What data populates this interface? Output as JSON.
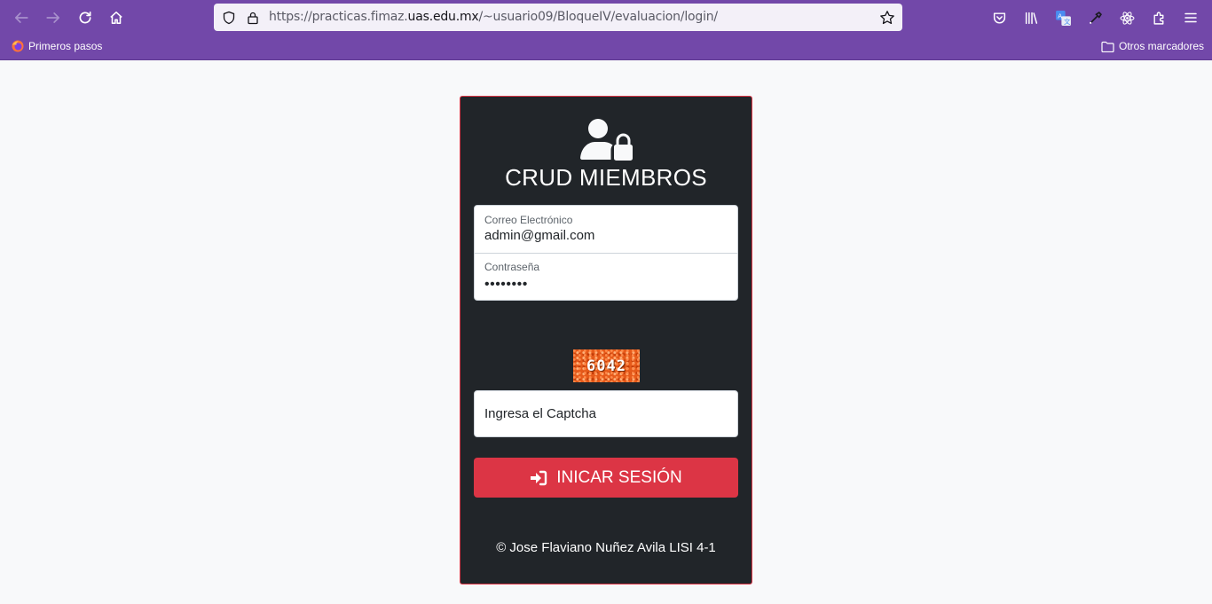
{
  "browser": {
    "url_prefix": "https://practicas.fimaz.",
    "url_host": "uas.edu.mx",
    "url_path": "/~usuario09/BloqueIV/evaluacion/login/",
    "bookmarks": {
      "left": {
        "label": "Primeros pasos",
        "icon": "firefox-icon"
      },
      "right": {
        "label": "Otros marcadores",
        "icon": "folder-icon"
      }
    },
    "toolbar_icons": [
      "pocket-icon",
      "library-icon",
      "translate-icon",
      "eyedropper-icon",
      "react-devtools-icon",
      "extensions-icon",
      "menu-icon"
    ],
    "colors": {
      "chrome": "#7248a9"
    }
  },
  "login": {
    "title": "CRUD MIEMBROS",
    "email_label": "Correo Electrónico",
    "email_value": "admin@gmail.com",
    "password_label": "Contraseña",
    "password_value": "••••••••",
    "captcha_code": "6042",
    "captcha_placeholder": "Ingresa el Captcha",
    "submit_label": "INICAR SESIÓN",
    "footer": "© Jose Flaviano Nuñez Avila LISI 4-1",
    "colors": {
      "card": "#212529",
      "accent": "#dc3545",
      "page": "#f8f9fa"
    }
  }
}
